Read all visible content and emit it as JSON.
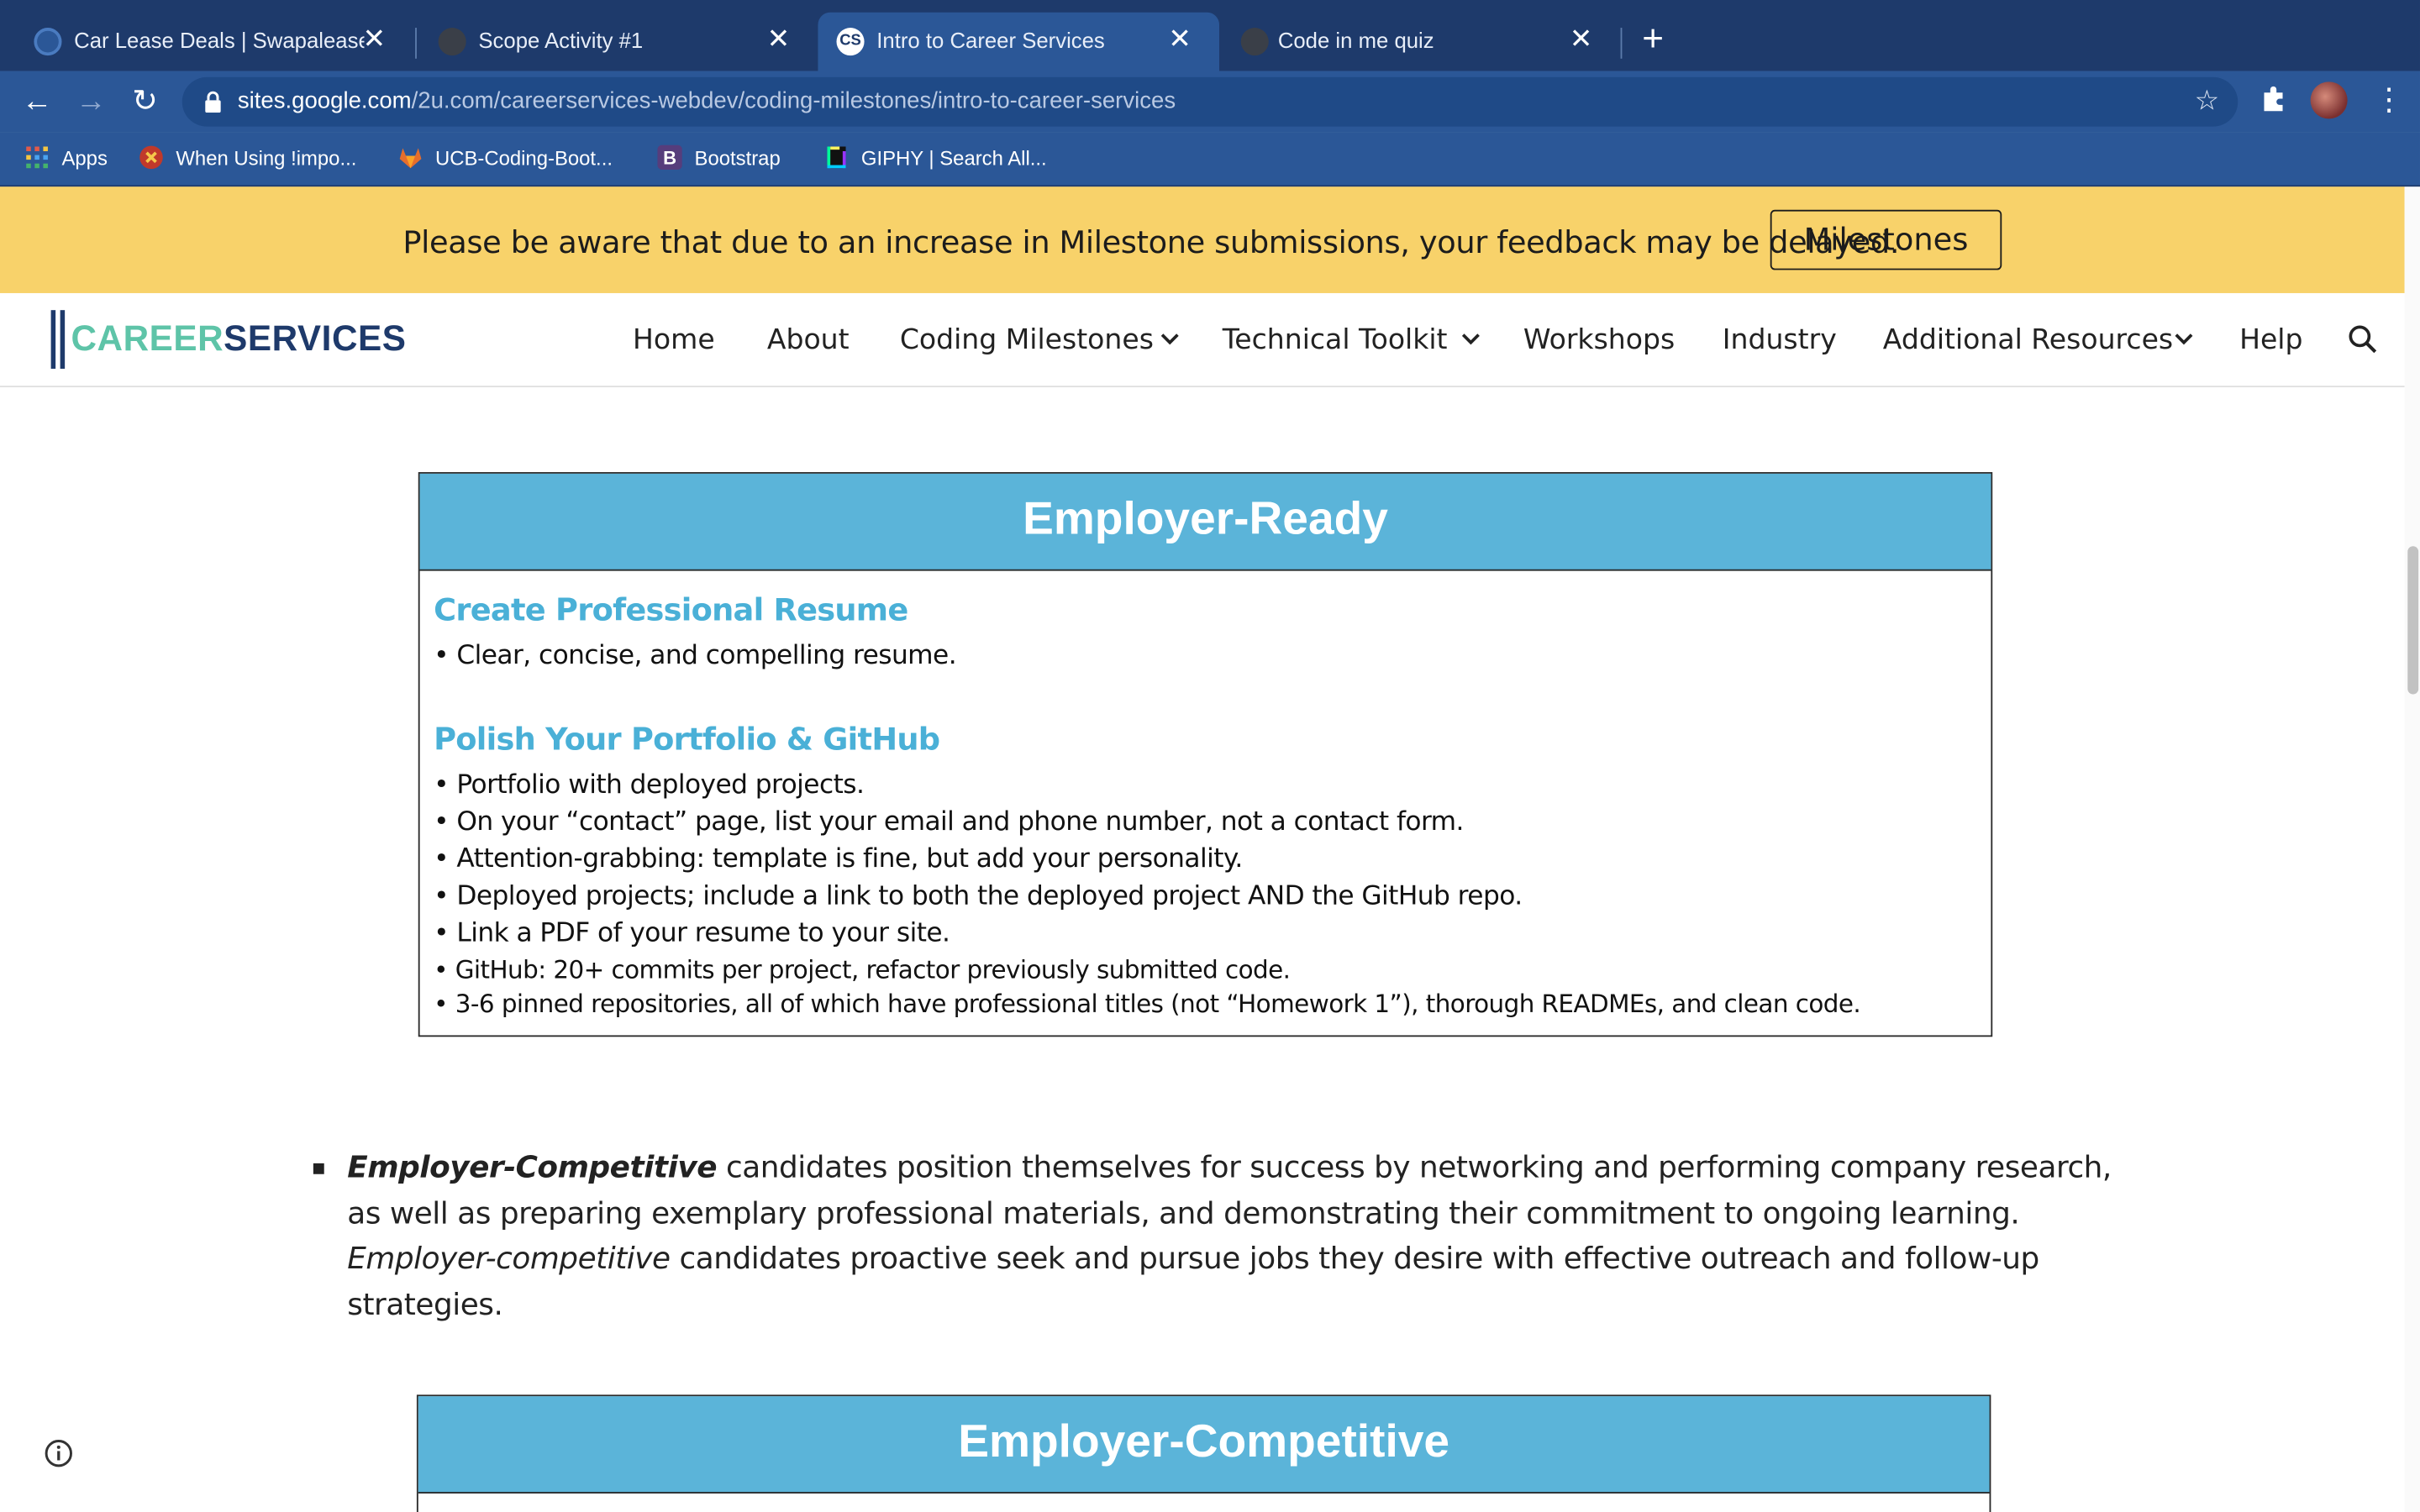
{
  "browser": {
    "tabs": [
      {
        "title": "Car Lease Deals | Swapalease.",
        "active": false
      },
      {
        "title": "Scope Activity #1",
        "active": false
      },
      {
        "title": "Intro to Career Services",
        "active": true
      },
      {
        "title": "Code in me quiz",
        "active": false
      }
    ],
    "url_host": "sites.google.com",
    "url_path": "/2u.com/careerservices-webdev/coding-milestones/intro-to-career-services",
    "bookmarks": [
      {
        "label": "Apps",
        "icon": "apps-grid-icon"
      },
      {
        "label": "When Using !impo...",
        "icon": "bookmark-favicon"
      },
      {
        "label": "UCB-Coding-Boot...",
        "icon": "gitlab-icon"
      },
      {
        "label": "Bootstrap",
        "icon": "bootstrap-icon"
      },
      {
        "label": "GIPHY | Search All...",
        "icon": "giphy-icon"
      }
    ]
  },
  "banner": {
    "text": "Please be aware that due to an increase in Milestone submissions, your feedback may be delayed.",
    "button_label": "Milestones"
  },
  "site": {
    "logo_part1": "CAREER",
    "logo_part2": "SERVICES",
    "nav": [
      {
        "label": "Home",
        "dropdown": false
      },
      {
        "label": "About",
        "dropdown": false
      },
      {
        "label": "Coding Milestones",
        "dropdown": true
      },
      {
        "label": "Technical Toolkit",
        "dropdown": true
      },
      {
        "label": "Workshops",
        "dropdown": false
      },
      {
        "label": "Industry",
        "dropdown": false
      },
      {
        "label": "Additional Resources",
        "dropdown": true
      },
      {
        "label": "Help",
        "dropdown": false
      }
    ]
  },
  "card1": {
    "title": "Employer-Ready",
    "section1_heading": "Create Professional Resume",
    "section1_items": [
      "• Clear, concise, and compelling resume."
    ],
    "section2_heading": "Polish Your Portfolio & GitHub",
    "section2_items": [
      "• Portfolio with deployed projects.",
      "• On your “contact” page, list your email and phone number, not a contact form.",
      "• Attention-grabbing: template is fine, but add your personality.",
      "• Deployed projects; include a link to both the deployed project AND the GitHub repo.",
      "• Link a PDF of your resume to your site.",
      "• GitHub: 20+ commits per project, refactor previously submitted code.",
      "• 3-6 pinned repositories, all of which have professional titles (not “Homework 1”), thorough READMEs, and clean code."
    ]
  },
  "paragraph": {
    "lead": "Employer-Competitive",
    "text1": " candidates position themselves for success by networking and performing company research, as well as preparing exemplary professional materials, and demonstrating their commitment to ongoing learning. ",
    "em": "Employer-competitive",
    "text2": " candidates proactive seek and pursue jobs they desire with effective outreach and follow-up strategies."
  },
  "card2": {
    "title": "Employer-Competitive"
  },
  "colors": {
    "banner_bg": "#f8d26a",
    "card_header": "#5bb4d9",
    "section_heading": "#4ab0d7",
    "logo_green": "#5ec4a8",
    "logo_navy": "#1e3a6b"
  }
}
